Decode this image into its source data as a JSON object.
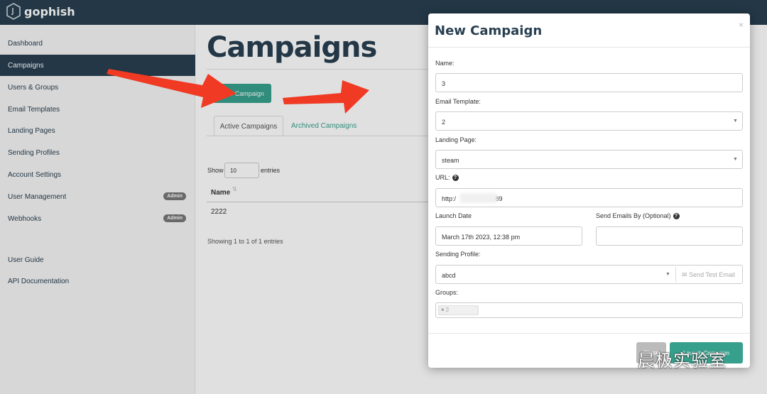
{
  "app": {
    "name": "gophish"
  },
  "sidebar": {
    "items": [
      {
        "label": "Dashboard"
      },
      {
        "label": "Campaigns"
      },
      {
        "label": "Users & Groups"
      },
      {
        "label": "Email Templates"
      },
      {
        "label": "Landing Pages"
      },
      {
        "label": "Sending Profiles"
      },
      {
        "label": "Account Settings"
      },
      {
        "label": "User Management",
        "badge": "Admin"
      },
      {
        "label": "Webhooks",
        "badge": "Admin"
      },
      {
        "label": "User Guide"
      },
      {
        "label": "API Documentation"
      }
    ],
    "active_index": 1
  },
  "main": {
    "title": "Campaigns",
    "new_button": "New Campaign",
    "tabs": [
      {
        "label": "Active Campaigns"
      },
      {
        "label": "Archived Campaigns"
      }
    ],
    "show_label": "Show",
    "show_value": "10",
    "entries_label": "entries",
    "table": {
      "columns": [
        "Name"
      ],
      "rows": [
        [
          "2222"
        ]
      ]
    },
    "showing_text": "Showing 1 to 1 of 1 entries"
  },
  "modal": {
    "title": "New Campaign",
    "close_symbol": "×",
    "name_label": "Name:",
    "name_value": "3",
    "template_label": "Email Template:",
    "template_value": "2",
    "landing_label": "Landing Page:",
    "landing_value": "steam",
    "url_label": "URL:",
    "url_value_start": "http:/",
    "url_value_end": ":89",
    "launch_label": "Launch Date",
    "launch_value": "March 17th 2023, 12:38 pm",
    "send_by_label": "Send Emails By (Optional)",
    "send_by_value": "",
    "profile_label": "Sending Profile:",
    "profile_value": "abcd",
    "test_email": "Send Test Email",
    "groups_label": "Groups:",
    "group_tag": "× 3",
    "close_button": "Close",
    "launch_button": "Launch Campaign"
  },
  "watermark": {
    "text": "晨极实验室"
  },
  "colors": {
    "brand_dark": "#283f50",
    "accent": "#37a08c",
    "arrow": "#f03a23"
  }
}
